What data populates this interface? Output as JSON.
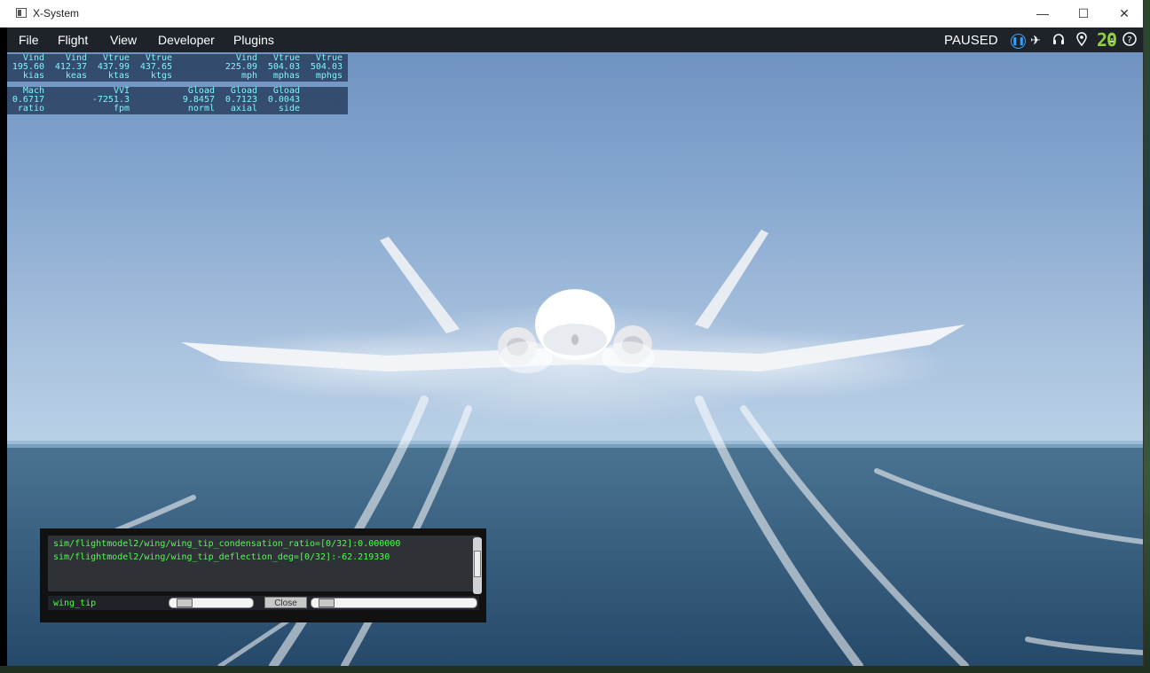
{
  "window": {
    "title": "X-System",
    "minimize_icon": "—",
    "maximize_icon": "☐",
    "close_icon": "✕"
  },
  "menu": {
    "items": [
      "File",
      "Flight",
      "View",
      "Developer",
      "Plugins"
    ],
    "status": "PAUSED",
    "fps": "20",
    "icons": [
      "pause-icon",
      "airplane-icon",
      "headset-icon",
      "location-pin-icon",
      "settings-icon",
      "help-icon"
    ]
  },
  "data_output": {
    "row1": [
      {
        "h": "Vind",
        "v": "195.60",
        "u": "kias"
      },
      {
        "h": "Vind",
        "v": "412.37",
        "u": "keas"
      },
      {
        "h": "Vtrue",
        "v": "437.99",
        "u": "ktas"
      },
      {
        "h": "Vtrue",
        "v": "437.65",
        "u": "ktgs"
      },
      {
        "h": "Vind",
        "v": "225.09",
        "u": "mph"
      },
      {
        "h": "Vtrue",
        "v": "504.03",
        "u": "mphas"
      },
      {
        "h": "Vtrue",
        "v": "504.03",
        "u": "mphgs"
      }
    ],
    "row2": [
      {
        "h": "Mach",
        "v": "0.6717",
        "u": "ratio"
      },
      {
        "h": "VVI",
        "v": "-7251.3",
        "u": "fpm"
      },
      {
        "h": "Gload",
        "v": "9.8457",
        "u": "norml"
      },
      {
        "h": "Gload",
        "v": "0.7123",
        "u": "axial"
      },
      {
        "h": "Gload",
        "v": "0.0043",
        "u": "side"
      }
    ]
  },
  "dataref_editor": {
    "lines": [
      "sim/flightmodel2/wing/wing_tip_condensation_ratio=[0/32]:0.000000",
      "sim/flightmodel2/wing/wing_tip_deflection_deg=[0/32]:-62.219330"
    ],
    "search_text": "wing_tip",
    "close_label": "Close"
  },
  "colors": {
    "data_text": "#7ff4ff",
    "dataref_text": "#4cff4c",
    "fps": "#8fd13a",
    "pause_accent": "#3aa0ff"
  }
}
